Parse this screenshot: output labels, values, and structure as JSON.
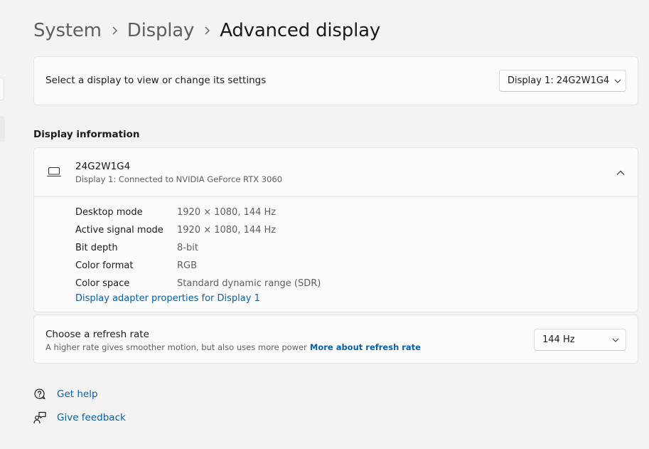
{
  "breadcrumb": {
    "items": [
      "System",
      "Display"
    ],
    "current": "Advanced display"
  },
  "display_selector": {
    "label": "Select a display to view or change its settings",
    "selected": "Display 1: 24G2W1G4"
  },
  "display_information": {
    "section_title": "Display information",
    "monitor_name": "24G2W1G4",
    "connection": "Display 1: Connected to NVIDIA GeForce RTX 3060",
    "rows": [
      {
        "key": "Desktop mode",
        "value": "1920 × 1080, 144 Hz"
      },
      {
        "key": "Active signal mode",
        "value": "1920 × 1080, 144 Hz"
      },
      {
        "key": "Bit depth",
        "value": "8-bit"
      },
      {
        "key": "Color format",
        "value": "RGB"
      },
      {
        "key": "Color space",
        "value": "Standard dynamic range (SDR)"
      }
    ],
    "adapter_link": "Display adapter properties for Display 1",
    "expanded": true
  },
  "refresh_rate": {
    "title": "Choose a refresh rate",
    "description": "A higher rate gives smoother motion, but also uses more power",
    "more_link": "More about refresh rate",
    "selected": "144 Hz"
  },
  "help": {
    "get_help": "Get help",
    "give_feedback": "Give feedback"
  },
  "icons": [
    "chevron-right-icon",
    "chevron-down-icon",
    "chevron-up-icon",
    "laptop-icon",
    "help-chat-icon",
    "feedback-icon"
  ],
  "colors": {
    "link": "#0b5ea8",
    "background": "#f3f3f3",
    "card": "#fbfbfb"
  }
}
